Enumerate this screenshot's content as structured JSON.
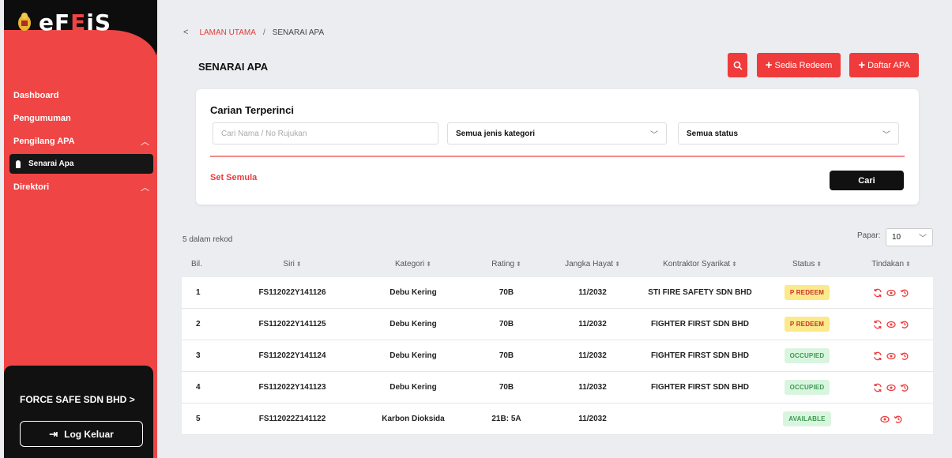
{
  "sidebar": {
    "logo_main": "eF",
    "logo_accent": "E",
    "logo_end": "iS",
    "nav": [
      {
        "label": "Dashboard"
      },
      {
        "label": "Pengumuman"
      },
      {
        "label": "Pengilang APA",
        "icon": "chevron-up-icon"
      },
      {
        "label": "Senarai Apa",
        "active": true
      },
      {
        "label": "Direktori",
        "icon": "chevron-up-icon"
      }
    ],
    "company": "FORCE SAFE SDN BHD",
    "company_chevron": ">",
    "logout": "Log Keluar"
  },
  "breadcrumb": {
    "back": "<",
    "home": "LAMAN UTAMA",
    "sep": "/",
    "current": "SENARAI APA"
  },
  "page_title": "SENARAI APA",
  "buttons": {
    "sedia_redeem": "Sedia Redeem",
    "daftar_apa": "Daftar APA"
  },
  "search": {
    "title": "Carian Terperinci",
    "name_placeholder": "Cari Nama / No Rujukan",
    "category_value": "Semua jenis kategori",
    "status_value": "Semua status",
    "reset": "Set Semula",
    "submit": "Cari"
  },
  "table": {
    "record_count": "5 dalam rekod",
    "show_label": "Papar:",
    "show_value": "10",
    "headers": [
      "Bil.",
      "Siri",
      "Kategori",
      "Rating",
      "Jangka Hayat",
      "Kontraktor Syarikat",
      "Status",
      "Tindakan"
    ],
    "rows": [
      {
        "bil": "1",
        "siri": "FS112022Y141126",
        "kategori": "Debu Kering",
        "rating": "70B",
        "hayat": "11/2032",
        "kontraktor": "STI FIRE SAFETY SDN BHD",
        "status": "P REDEEM",
        "status_type": "redeem",
        "actions": [
          "refresh",
          "view",
          "history"
        ]
      },
      {
        "bil": "2",
        "siri": "FS112022Y141125",
        "kategori": "Debu Kering",
        "rating": "70B",
        "hayat": "11/2032",
        "kontraktor": "FIGHTER FIRST SDN BHD",
        "status": "P REDEEM",
        "status_type": "redeem",
        "actions": [
          "refresh",
          "view",
          "history"
        ]
      },
      {
        "bil": "3",
        "siri": "FS112022Y141124",
        "kategori": "Debu Kering",
        "rating": "70B",
        "hayat": "11/2032",
        "kontraktor": "FIGHTER FIRST SDN BHD",
        "status": "OCCUPIED",
        "status_type": "occupied",
        "actions": [
          "refresh",
          "view",
          "history"
        ]
      },
      {
        "bil": "4",
        "siri": "FS112022Y141123",
        "kategori": "Debu Kering",
        "rating": "70B",
        "hayat": "11/2032",
        "kontraktor": "FIGHTER FIRST SDN BHD",
        "status": "OCCUPIED",
        "status_type": "occupied",
        "actions": [
          "refresh",
          "view",
          "history"
        ]
      },
      {
        "bil": "5",
        "siri": "FS112022Z141122",
        "kategori": "Karbon Dioksida",
        "rating": "21B: 5A",
        "hayat": "11/2032",
        "kontraktor": "",
        "status": "AVAILABLE",
        "status_type": "available",
        "actions": [
          "view",
          "history"
        ]
      }
    ]
  },
  "colors": {
    "primary_red": "#ef3b3b",
    "redeem_bg": "#fbe98a",
    "redeem_fg": "#c9302c",
    "occupied_bg": "#d9f5df",
    "occupied_fg": "#3a9a4e",
    "available_bg": "#d9f5df",
    "available_fg": "#3a9a4e"
  }
}
